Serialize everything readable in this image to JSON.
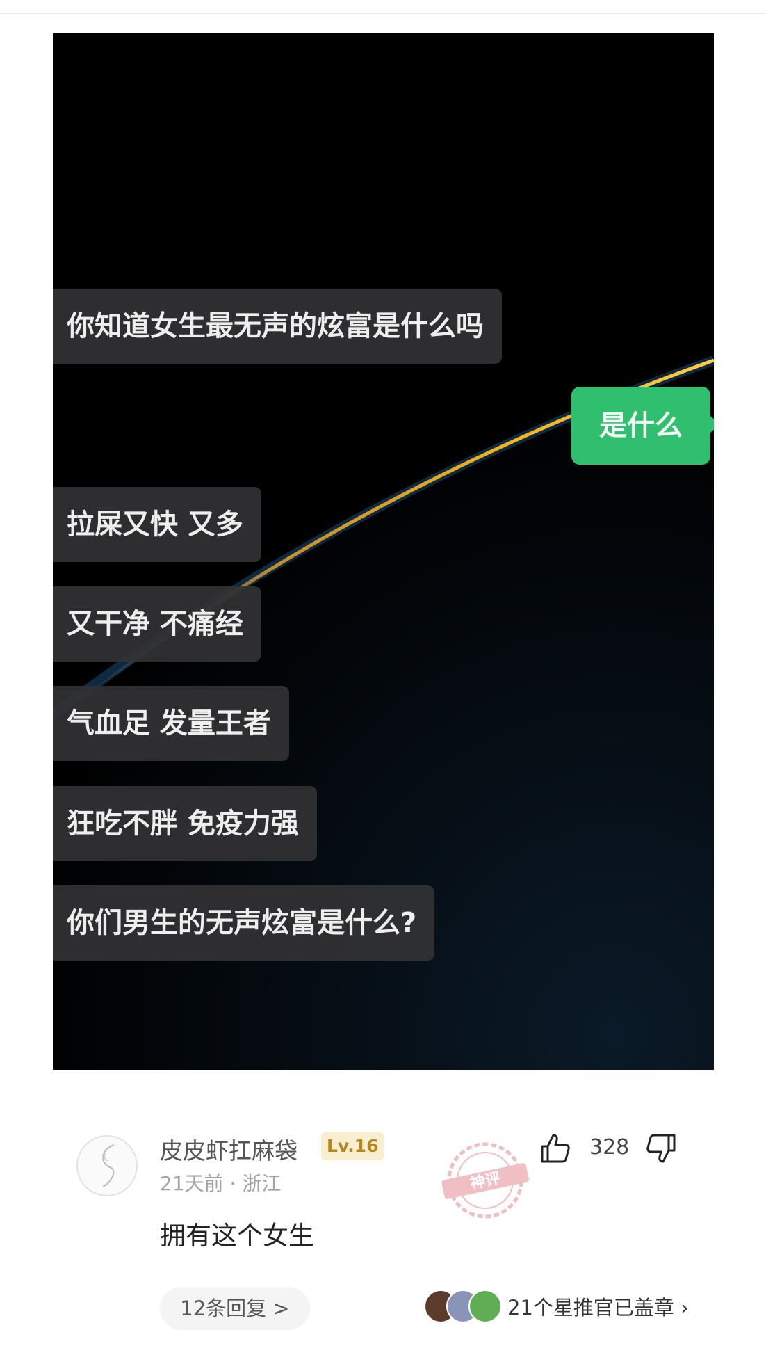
{
  "chat": {
    "bubbles": [
      "你知道女生最无声的炫富是什么吗",
      "拉屎又快 又多",
      "又干净 不痛经",
      "气血足 发量王者",
      "狂吃不胖 免疫力强",
      "你们男生的无声炫富是什么?"
    ],
    "reply": "是什么"
  },
  "comment": {
    "username": "皮皮虾扛麻袋",
    "level": "Lv.16",
    "time": "21天前",
    "separator": "·",
    "location": "浙江",
    "text": "拥有这个女生",
    "likes": "328",
    "stamp_label": "神评",
    "replies": "12条回复 >",
    "stamp_summary": "21个星推官已盖章",
    "stamp_chevron": "›"
  },
  "colors": {
    "accent_green": "#2fbf6e",
    "level_badge": "#b3861f",
    "stamp_red": "#e58b93"
  },
  "icons": [
    "thumbs-up-icon",
    "thumbs-down-icon",
    "chevron-right-icon"
  ]
}
